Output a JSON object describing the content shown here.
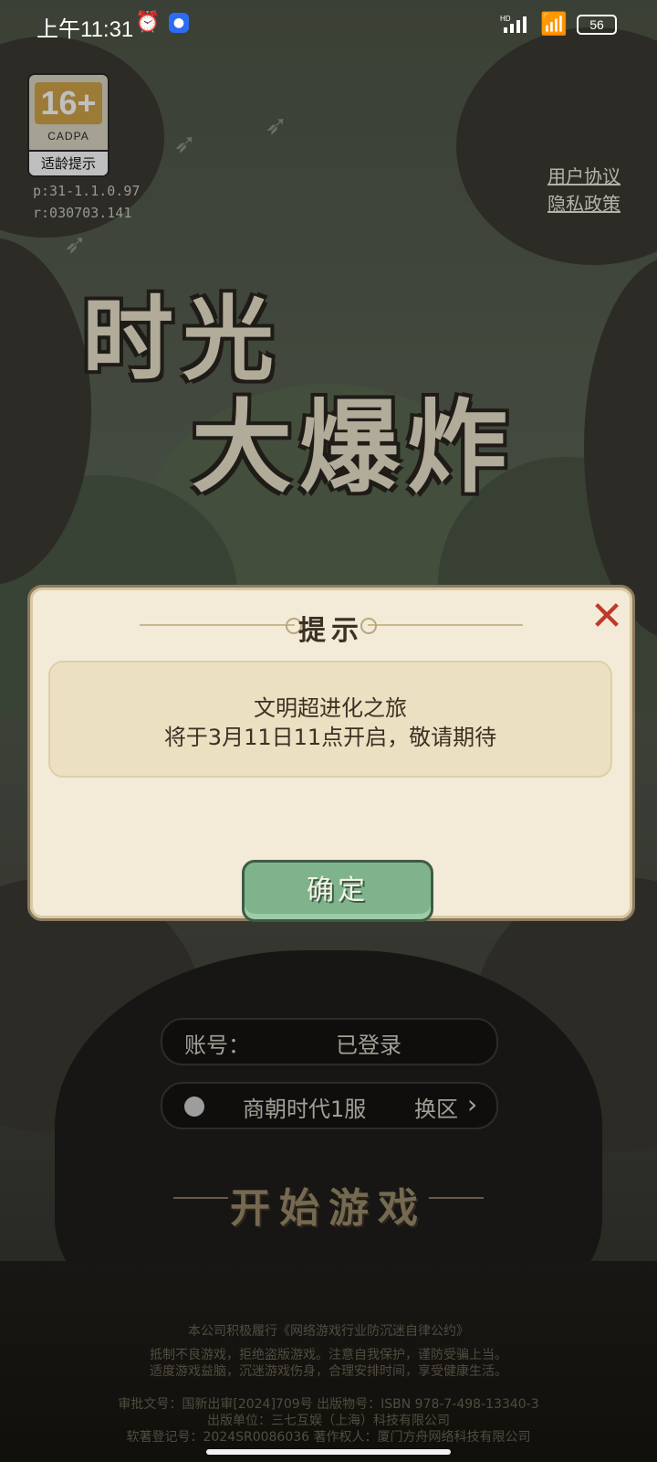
{
  "status_bar": {
    "time": "上午11:31",
    "alarm_icon": "alarm-clock-icon",
    "network_label": "HD",
    "battery_level": "56"
  },
  "age_rating": {
    "age": "16+",
    "org": "CADPA",
    "label": "适龄提示"
  },
  "version": {
    "line1": "p:31-1.1.0.97",
    "line2": "r:030703.141"
  },
  "links": {
    "user_agreement": "用户协议",
    "privacy_policy": "隐私政策"
  },
  "game_logo": {
    "line1": "时光",
    "line2": "大爆炸"
  },
  "dialog": {
    "title": "提示",
    "message_line1": "文明超进化之旅",
    "message_line2": "将于3月11日11点开启，敬请期待",
    "confirm_label": "确定",
    "close_icon": "close-x-icon"
  },
  "login": {
    "account_label": "账号：",
    "account_value": "已登录",
    "server_name": "商朝时代1服",
    "switch_label": "换区",
    "start_label": "开始游戏"
  },
  "legal": {
    "line1": "本公司积极履行《网络游戏行业防沉迷自律公约》",
    "line2": "抵制不良游戏，拒绝盗版游戏。注意自我保护，谨防受骗上当。",
    "line3": "适度游戏益脑，沉迷游戏伤身，合理安排时间，享受健康生活。",
    "line4": "审批文号：国新出审[2024]709号 出版物号：ISBN 978-7-498-13340-3",
    "line5": "出版单位：三七互娱（上海）科技有限公司",
    "line6": "软著登记号：2024SR0086036 著作权人：厦门方舟网络科技有限公司"
  },
  "colors": {
    "dialog_bg": "#f3ebd8",
    "confirm_button": "#7fb38c",
    "close_red": "#c0392b"
  }
}
